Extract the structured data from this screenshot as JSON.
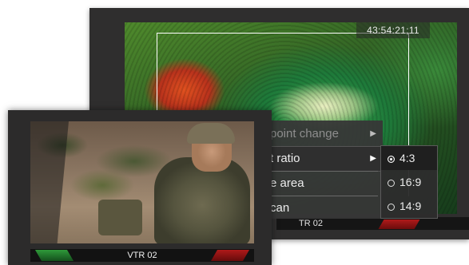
{
  "back_monitor": {
    "timecode": "43:54:21;11",
    "label": "TR 02"
  },
  "context_menu": {
    "items": [
      {
        "label": "point change",
        "disabled": true,
        "has_submenu": true
      },
      {
        "label": "t ratio",
        "disabled": false,
        "has_submenu": true,
        "highlighted": true
      },
      {
        "label": "e area",
        "disabled": false,
        "has_submenu": false
      },
      {
        "label": "can",
        "disabled": false,
        "has_submenu": false
      }
    ]
  },
  "aspect_submenu": {
    "options": [
      {
        "label": "4:3",
        "selected": true
      },
      {
        "label": "16:9",
        "selected": false
      },
      {
        "label": "14:9",
        "selected": false
      }
    ]
  },
  "front_monitor": {
    "label": "VTR 02"
  },
  "colors": {
    "tally_green": "#2f9a3a",
    "tally_red": "#b01a1a",
    "window_bg": "#2f2e2e"
  }
}
